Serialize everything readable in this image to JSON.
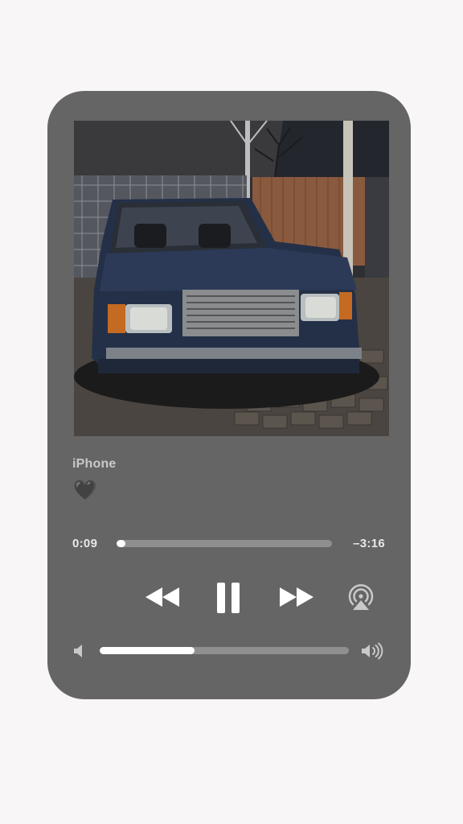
{
  "track": {
    "title": "iPhone",
    "artist": "🖤"
  },
  "playback": {
    "elapsed": "0:09",
    "remaining": "–3:16",
    "progress_fraction": 0.04,
    "volume_fraction": 0.38,
    "state": "playing"
  },
  "icons": {
    "rewind": "rewind-icon",
    "pause": "pause-icon",
    "forward": "fast-forward-icon",
    "airplay": "airplay-icon",
    "volume_low": "speaker-low-icon",
    "volume_high": "speaker-high-icon"
  },
  "colors": {
    "background": "#f8f6f7",
    "player": "#656565",
    "bar_track": "#8f8f8f",
    "bar_fill": "#ffffff",
    "title_text": "#c9c9c9"
  }
}
